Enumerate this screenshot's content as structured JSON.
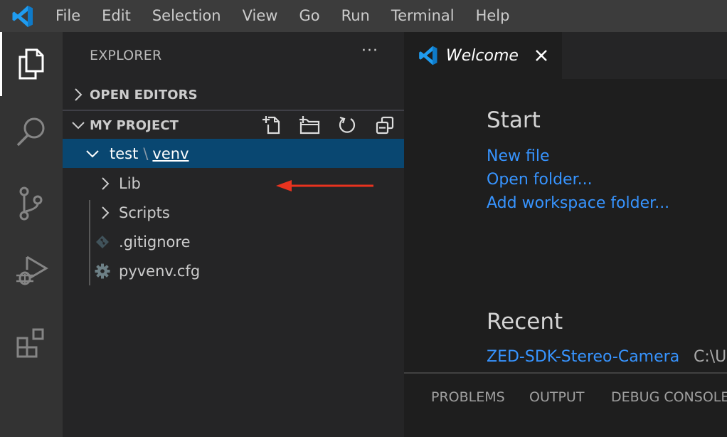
{
  "menubar": {
    "app_icon": "vscode-logo-icon",
    "items": [
      "File",
      "Edit",
      "Selection",
      "View",
      "Go",
      "Run",
      "Terminal",
      "Help"
    ]
  },
  "activitybar": {
    "items": [
      {
        "name": "explorer",
        "icon": "files-icon",
        "active": true
      },
      {
        "name": "search",
        "icon": "search-icon",
        "active": false
      },
      {
        "name": "source-control",
        "icon": "source-control-icon",
        "active": false
      },
      {
        "name": "run-and-debug",
        "icon": "debug-icon",
        "active": false
      },
      {
        "name": "extensions",
        "icon": "extensions-icon",
        "active": false
      }
    ]
  },
  "sidebar": {
    "title": "EXPLORER",
    "more_label": "···",
    "open_editors": {
      "label": "OPEN EDITORS",
      "expanded": false
    },
    "project": {
      "label": "MY PROJECT",
      "expanded": true,
      "actions": [
        "new-file-icon",
        "new-folder-icon",
        "refresh-icon",
        "collapse-all-icon"
      ]
    },
    "tree": {
      "selected_folder": {
        "parent": "test",
        "separator": "\\",
        "name": "venv",
        "expanded": true
      },
      "children": [
        {
          "label": "Lib",
          "type": "folder",
          "icon": "chevron-right-icon"
        },
        {
          "label": "Scripts",
          "type": "folder",
          "icon": "chevron-right-icon"
        },
        {
          "label": ".gitignore",
          "type": "file",
          "icon": "git-icon"
        },
        {
          "label": "pyvenv.cfg",
          "type": "file",
          "icon": "gear-icon"
        }
      ]
    },
    "annotation": {
      "type": "arrow",
      "color": "#e8331f",
      "points_to": "test \\ venv"
    }
  },
  "editor": {
    "tabs": [
      {
        "label": "Welcome",
        "icon": "vscode-logo-icon",
        "close": "×",
        "active": true
      }
    ],
    "welcome": {
      "start_heading": "Start",
      "start_links": [
        "New file",
        "Open folder...",
        "Add workspace folder..."
      ],
      "recent_heading": "Recent",
      "recent_items": [
        {
          "name": "ZED-SDK-Stereo-Camera",
          "path": "C:\\U"
        }
      ]
    }
  },
  "panel": {
    "tabs": [
      "PROBLEMS",
      "OUTPUT",
      "DEBUG CONSOLE"
    ]
  },
  "colors": {
    "accent_link": "#3794ff",
    "selection": "#094771",
    "vscode_blue": "#1f9cf0",
    "annotation_red": "#e8331f"
  }
}
